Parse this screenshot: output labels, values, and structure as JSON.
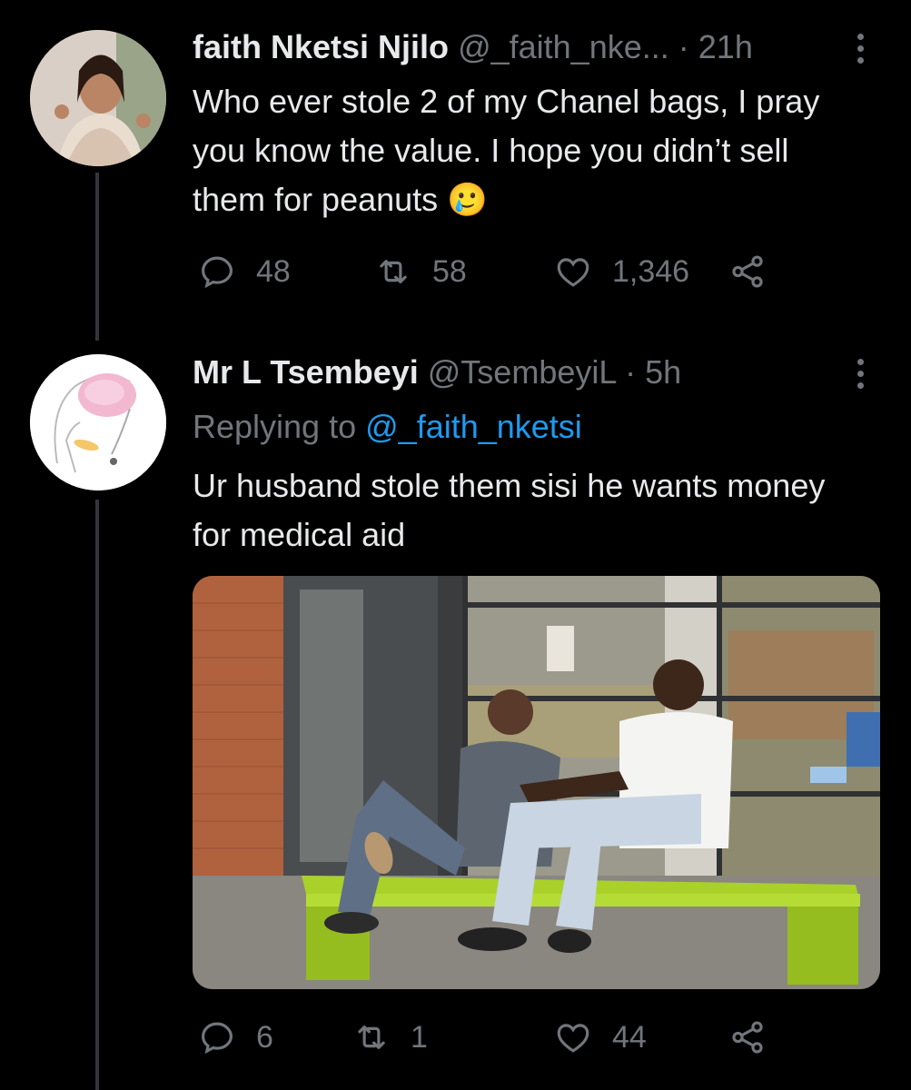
{
  "tweets": [
    {
      "display_name": "faith Nketsi Njilo",
      "handle": "@_faith_nke...",
      "separator": "·",
      "time": "21h",
      "text": "Who ever stole 2 of my Chanel bags, I pray you know the value. I hope you didn’t sell them for peanuts 🥲",
      "replies": "48",
      "retweets": "58",
      "likes": "1,346"
    },
    {
      "display_name": "Mr L Tsembeyi",
      "handle": "@TsembeyiL",
      "separator": "·",
      "time": "5h",
      "replying_label": "Replying to",
      "replying_handle": "@_faith_nketsi",
      "text": "Ur husband stole them sisi he wants money for medical aid",
      "replies": "6",
      "retweets": "1",
      "likes": "44"
    }
  ],
  "icons": {
    "more": "more-icon",
    "reply": "reply-icon",
    "retweet": "retweet-icon",
    "like": "heart-icon",
    "share": "share-icon"
  },
  "colors": {
    "background": "#000000",
    "text": "#e7e9ea",
    "muted": "#71767b",
    "link": "#1d9bf0"
  }
}
